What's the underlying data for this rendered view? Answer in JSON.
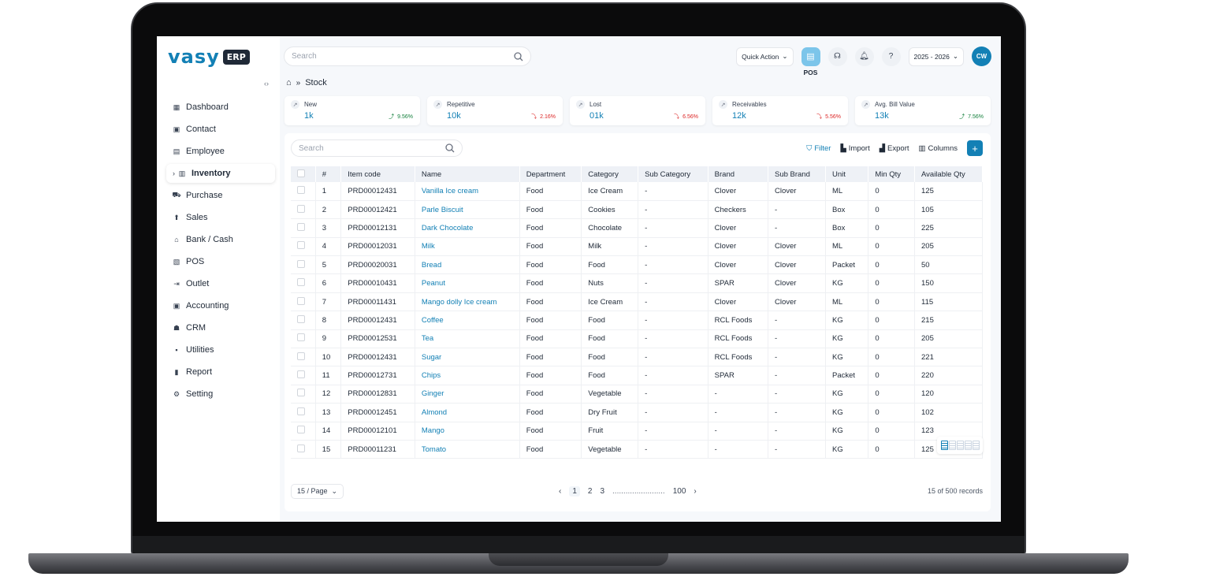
{
  "app": {
    "logo_text": "vasy",
    "logo_badge": "ERP"
  },
  "sidebar": {
    "items": [
      {
        "label": "Dashboard",
        "icon": "dashboard-icon",
        "glyph": "▦"
      },
      {
        "label": "Contact",
        "icon": "contact-icon",
        "glyph": "▣"
      },
      {
        "label": "Employee",
        "icon": "employee-icon",
        "glyph": "▤"
      },
      {
        "label": "Inventory",
        "icon": "inventory-icon",
        "glyph": "▥",
        "active": true
      },
      {
        "label": "Purchase",
        "icon": "cart-icon",
        "glyph": "⛟"
      },
      {
        "label": "Sales",
        "icon": "sales-icon",
        "glyph": "⬆"
      },
      {
        "label": "Bank / Cash",
        "icon": "bank-icon",
        "glyph": "⌂"
      },
      {
        "label": "POS",
        "icon": "pos-icon",
        "glyph": "▧"
      },
      {
        "label": "Outlet",
        "icon": "outlet-icon",
        "glyph": "⇥"
      },
      {
        "label": "Accounting",
        "icon": "accounting-icon",
        "glyph": "▣"
      },
      {
        "label": "CRM",
        "icon": "crm-icon",
        "glyph": "☗"
      },
      {
        "label": "Utilities",
        "icon": "utilities-icon",
        "glyph": "▪"
      },
      {
        "label": "Report",
        "icon": "report-icon",
        "glyph": "▮"
      },
      {
        "label": "Setting",
        "icon": "gear-icon",
        "glyph": "⚙"
      }
    ]
  },
  "header": {
    "search_placeholder": "Search",
    "quick_action": "Quick Action",
    "pos_label": "POS",
    "year": "2025 - 2026",
    "avatar_initials": "CW"
  },
  "breadcrumb": {
    "current": "Stock"
  },
  "stats": [
    {
      "title": "New",
      "value": "1k",
      "change": "9.56%",
      "trend": "up"
    },
    {
      "title": "Repetitive",
      "value": "10k",
      "change": "2.16%",
      "trend": "down"
    },
    {
      "title": "Lost",
      "value": "01k",
      "change": "6.56%",
      "trend": "down"
    },
    {
      "title": "Receivables",
      "value": "12k",
      "change": "5.56%",
      "trend": "down"
    },
    {
      "title": "Avg. Bill Value",
      "value": "13k",
      "change": "7.56%",
      "trend": "up"
    }
  ],
  "table_panel": {
    "search_placeholder": "Search",
    "filter": "Filter",
    "import": "Import",
    "export": "Export",
    "columns": "Columns",
    "add": "+"
  },
  "table": {
    "headers": [
      "#",
      "Item code",
      "Name",
      "Department",
      "Category",
      "Sub Category",
      "Brand",
      "Sub Brand",
      "Unit",
      "Min Qty",
      "Available Qty"
    ],
    "rows": [
      [
        "1",
        "PRD00012431",
        "Vanilla Ice cream",
        "Food",
        "Ice Cream",
        "-",
        "Clover",
        "Clover",
        "ML",
        "0",
        "125"
      ],
      [
        "2",
        "PRD00012421",
        "Parle Biscuit",
        "Food",
        "Cookies",
        "-",
        "Checkers",
        "-",
        "Box",
        "0",
        "105"
      ],
      [
        "3",
        "PRD00012131",
        "Dark Chocolate",
        "Food",
        "Chocolate",
        "-",
        "Clover",
        "-",
        "Box",
        "0",
        "225"
      ],
      [
        "4",
        "PRD00012031",
        "Milk",
        "Food",
        "Milk",
        "-",
        "Clover",
        "Clover",
        "ML",
        "0",
        "205"
      ],
      [
        "5",
        "PRD00020031",
        "Bread",
        "Food",
        "Food",
        "-",
        "Clover",
        "Clover",
        "Packet",
        "0",
        "50"
      ],
      [
        "6",
        "PRD00010431",
        "Peanut",
        "Food",
        "Nuts",
        "-",
        "SPAR",
        "Clover",
        "KG",
        "0",
        "150"
      ],
      [
        "7",
        "PRD00011431",
        "Mango dolly Ice cream",
        "Food",
        "Ice Cream",
        "-",
        "Clover",
        "Clover",
        "ML",
        "0",
        "115"
      ],
      [
        "8",
        "PRD00012431",
        "Coffee",
        "Food",
        "Food",
        "-",
        "RCL Foods",
        "-",
        "KG",
        "0",
        "215"
      ],
      [
        "9",
        "PRD00012531",
        "Tea",
        "Food",
        "Food",
        "-",
        "RCL Foods",
        "-",
        "KG",
        "0",
        "205"
      ],
      [
        "10",
        "PRD00012431",
        "Sugar",
        "Food",
        "Food",
        "-",
        "RCL Foods",
        "-",
        "KG",
        "0",
        "221"
      ],
      [
        "11",
        "PRD00012731",
        "Chips",
        "Food",
        "Food",
        "-",
        "SPAR",
        "-",
        "Packet",
        "0",
        "220"
      ],
      [
        "12",
        "PRD00012831",
        "Ginger",
        "Food",
        "Vegetable",
        "-",
        "-",
        "-",
        "KG",
        "0",
        "120"
      ],
      [
        "13",
        "PRD00012451",
        "Almond",
        "Food",
        "Dry Fruit",
        "-",
        "-",
        "-",
        "KG",
        "0",
        "102"
      ],
      [
        "14",
        "PRD00012101",
        "Mango",
        "Food",
        "Fruit",
        "-",
        "-",
        "-",
        "KG",
        "0",
        "123"
      ],
      [
        "15",
        "PRD00011231",
        "Tomato",
        "Food",
        "Vegetable",
        "-",
        "-",
        "-",
        "KG",
        "0",
        "125"
      ]
    ]
  },
  "footer": {
    "per_page": "15 / Page",
    "pages": [
      "1",
      "2",
      "3"
    ],
    "ellipsis": "........................",
    "last_page": "100",
    "records": "15 of 500 records"
  },
  "colors": {
    "accent": "#1380b5",
    "up": "#15803d",
    "down": "#dc2626"
  }
}
